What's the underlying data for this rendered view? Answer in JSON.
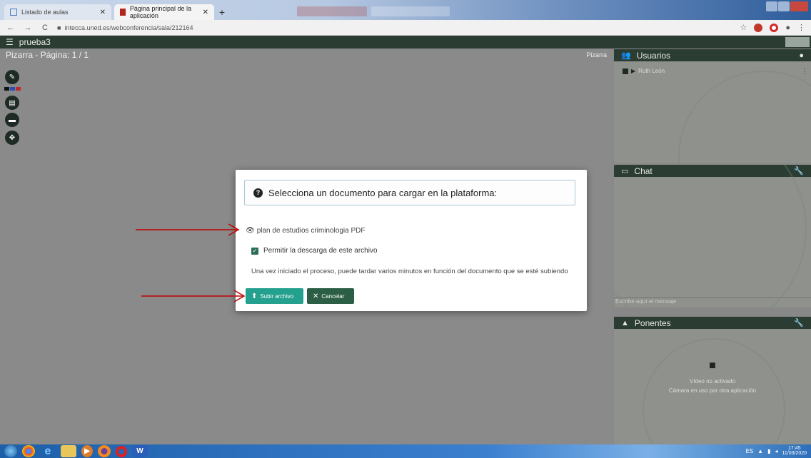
{
  "browser": {
    "tabs": [
      {
        "title": "Listado de aulas",
        "active": false
      },
      {
        "title": "Página principal de la aplicación",
        "active": true
      }
    ],
    "new_tab_icon": "+",
    "url": "intecca.uned.es/webconferencia/sala/212164"
  },
  "app": {
    "room_name": "prueba3",
    "board_title": "Pizarra - Página: 1 / 1",
    "board_mode": "Pizarra"
  },
  "panels": {
    "users": {
      "title": "Usuarios",
      "user_name": "Ruth León"
    },
    "chat": {
      "title": "Chat",
      "input_placeholder": "Escribe aquí el mensaje"
    },
    "speakers": {
      "title": "Ponentes",
      "video_status": "Vídeo no activado",
      "camera_status": "Cámara en uso por otra aplicación"
    }
  },
  "dialog": {
    "title": "Selecciona un documento para cargar en la plataforma:",
    "file_name": "plan de estudios criminologia PDF",
    "checkbox_label": "Permitir la descarga de este archivo",
    "checkbox_checked": true,
    "info": "Una vez iniciado el proceso, puede tardar varios minutos en función del documento que se esté subiendo",
    "upload_label": "Subir archivo",
    "cancel_label": "Cancelar"
  },
  "taskbar": {
    "time": "17:45",
    "date": "11/03/2020"
  },
  "colors": {
    "header_green": "#2b3d32",
    "upload_teal": "#24a08f",
    "cancel_green": "#2b5e44",
    "arrow_red": "#c00000"
  }
}
